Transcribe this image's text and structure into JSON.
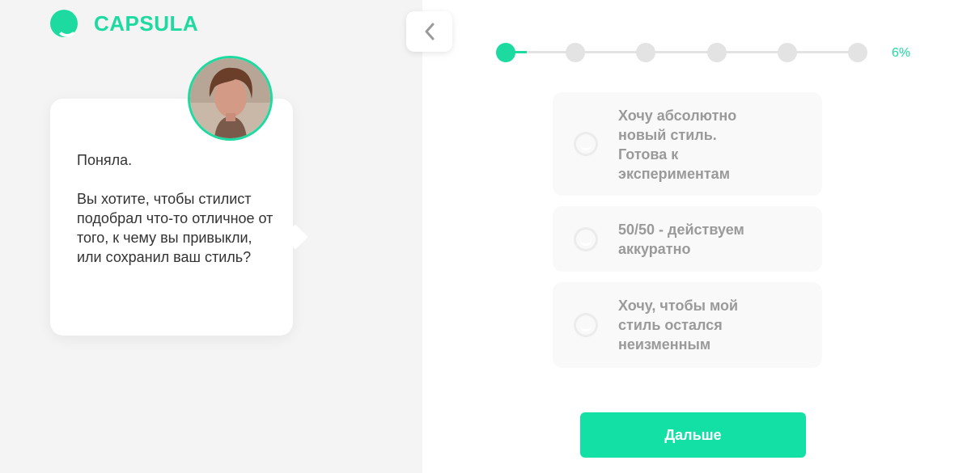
{
  "brand": {
    "name": "CAPSULA",
    "accent": "#1ddba0",
    "logo_icon": "smile-circle-icon"
  },
  "nav": {
    "back_icon": "chevron-left-icon"
  },
  "chat": {
    "avatar": "stylist-avatar",
    "message": "Поняла.\n\nВы хотите, чтобы стилист подобрал что-то отличное от того, к чему вы привыкли, или сохранил ваш стиль?"
  },
  "progress": {
    "steps": 6,
    "current_step": 1,
    "percent_label": "6%",
    "percent_value": 6
  },
  "options": [
    {
      "label": "Хочу абсолютно\nновый стиль.\nГотова к\nэкспериментам"
    },
    {
      "label": "50/50 - действуем\nаккуратно"
    },
    {
      "label": "Хочу, чтобы мой\nстиль остался\nнеизменным"
    }
  ],
  "actions": {
    "next_label": "Дальше"
  }
}
